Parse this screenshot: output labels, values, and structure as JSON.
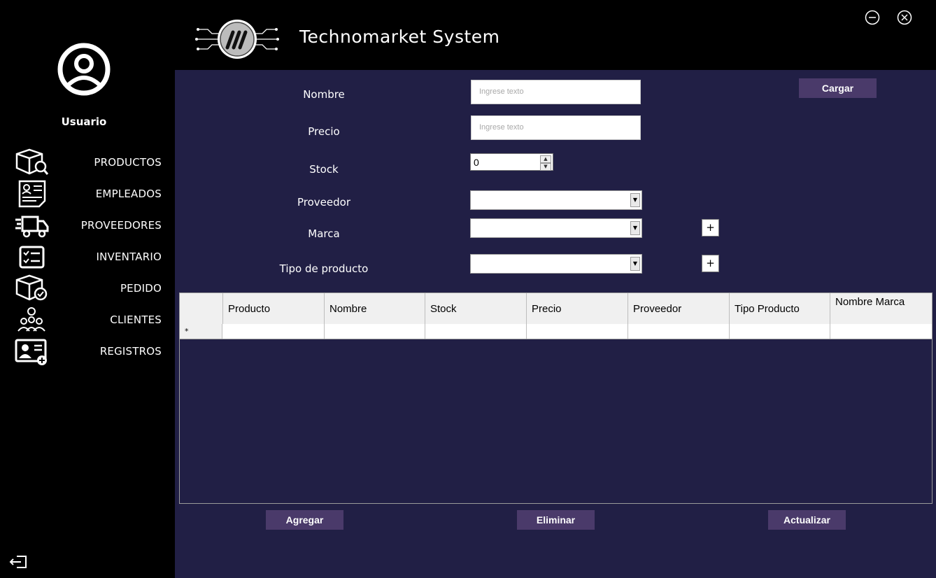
{
  "window": {
    "title": "Technomarket System",
    "minimize_icon": "minimize-icon",
    "close_icon": "close-icon"
  },
  "sidebar": {
    "user_label": "Usuario",
    "items": [
      {
        "label": "PRODUCTOS",
        "icon": "box-search-icon"
      },
      {
        "label": "EMPLEADOS",
        "icon": "resume-document-icon"
      },
      {
        "label": "PROVEEDORES",
        "icon": "delivery-truck-icon"
      },
      {
        "label": "INVENTARIO",
        "icon": "checklist-icon"
      },
      {
        "label": "PEDIDO",
        "icon": "box-check-icon"
      },
      {
        "label": "CLIENTES",
        "icon": "customers-icon"
      },
      {
        "label": "REGISTROS",
        "icon": "add-user-card-icon"
      }
    ],
    "logout_icon": "logout-icon"
  },
  "form": {
    "nombre_label": "Nombre",
    "nombre_placeholder": "Ingrese texto",
    "precio_label": "Precio",
    "precio_placeholder": "Ingrese texto",
    "stock_label": "Stock",
    "stock_value": "0",
    "proveedor_label": "Proveedor",
    "proveedor_value": "",
    "marca_label": "Marca",
    "marca_value": "",
    "tipo_label": "Tipo de producto",
    "tipo_value": "",
    "plus_label": "+",
    "cargar_label": "Cargar"
  },
  "table": {
    "columns": [
      "Producto",
      "Nombre",
      "Stock",
      "Precio",
      "Proveedor",
      "Tipo Producto",
      "Nombre Marca"
    ],
    "new_row_marker": "*",
    "rows": []
  },
  "actions": {
    "agregar": "Agregar",
    "eliminar": "Eliminar",
    "actualizar": "Actualizar"
  },
  "colors": {
    "sidebar_bg": "#000000",
    "main_bg": "#211f45",
    "button_bg": "#4a3a6a"
  }
}
